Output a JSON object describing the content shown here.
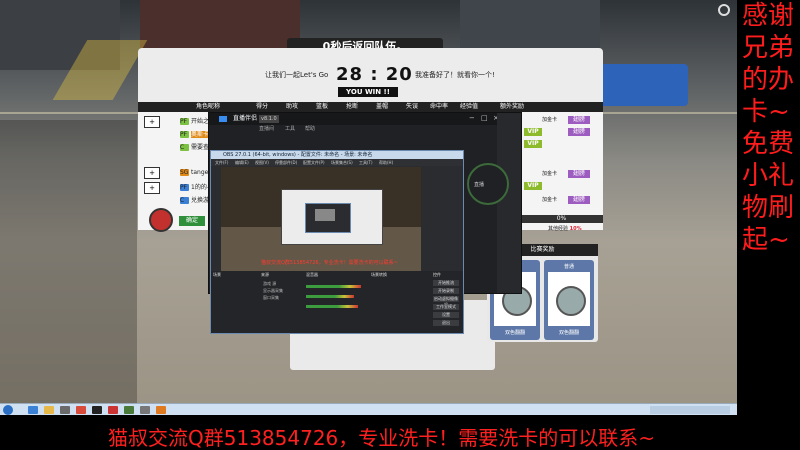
{
  "game": {
    "countdown": "0秒后返回队伍。",
    "chat_left": "让我们一起Let's Go",
    "chat_right": "我准备好了！就看你一个!",
    "timer": "28 : 20",
    "result": "YOU WIN !!",
    "headers": [
      "角色昵称",
      "得分",
      "助攻",
      "篮板",
      "抢断",
      "盖帽",
      "失误",
      "命中率",
      "经验值",
      "额外奖励"
    ],
    "players": [
      {
        "tag": "PF",
        "name": "开始之光"
      },
      {
        "tag": "PF",
        "name": "奥斯卡之王"
      },
      {
        "tag": "C",
        "name": "需要查号"
      },
      {
        "tag": "SG",
        "name": "tangel"
      },
      {
        "tag": "PF",
        "name": "1的的-c"
      },
      {
        "tag": "C",
        "name": "兑换游戏"
      }
    ],
    "confirm_label": "确定",
    "member_label": "加金卡",
    "vip_label": "VIP",
    "wing_label": "翅膀",
    "progress_percent": "0%",
    "exp_label": "其他经验",
    "exp_value": "10%",
    "bonus_title": "比赛奖励",
    "bonus_cards": [
      {
        "label": "",
        "footer": "双色翻翻"
      },
      {
        "label": "普通",
        "footer": "双色翻翻"
      }
    ]
  },
  "obs": {
    "title": "直播伴侣",
    "badge": "v8.1.0",
    "menu": [
      "直播间",
      "工具",
      "帮助"
    ],
    "record_label": "直播"
  },
  "capture": {
    "title": "OBS 27.0.1 (64-bit, windows) - 配置文件: 未命名 - 场景: 未命名",
    "menu": [
      "文件(F)",
      "编辑(E)",
      "视图(V)",
      "停靠部件(D)",
      "配置文件(P)",
      "场景集合(S)",
      "工具(T)",
      "帮助(H)"
    ],
    "preview_red": "猫叔交流Q群513854726，专业洗卡！需要洗卡的可以联系~",
    "docks": [
      "场景",
      "来源",
      "混音器",
      "场景转换",
      "控件"
    ],
    "sources": [
      "游戏 源",
      "显示器采集",
      "窗口采集"
    ],
    "controls": [
      "开始推流",
      "开始录制",
      "启动虚拟摄像机",
      "工作室模式",
      "设置",
      "退出"
    ]
  },
  "sidebar_text": "感谢兄弟的办卡~免费小礼物刷起~",
  "banner_text": "猫叔交流Q群513854726，专业洗卡！需要洗卡的可以联系~",
  "taskbar": {
    "icons": [
      "ie-icon",
      "folder-icon",
      "media-icon",
      "chrome-icon",
      "app-icon",
      "app-icon",
      "game-icon",
      "app-icon",
      "app-icon",
      "orange-icon"
    ]
  }
}
